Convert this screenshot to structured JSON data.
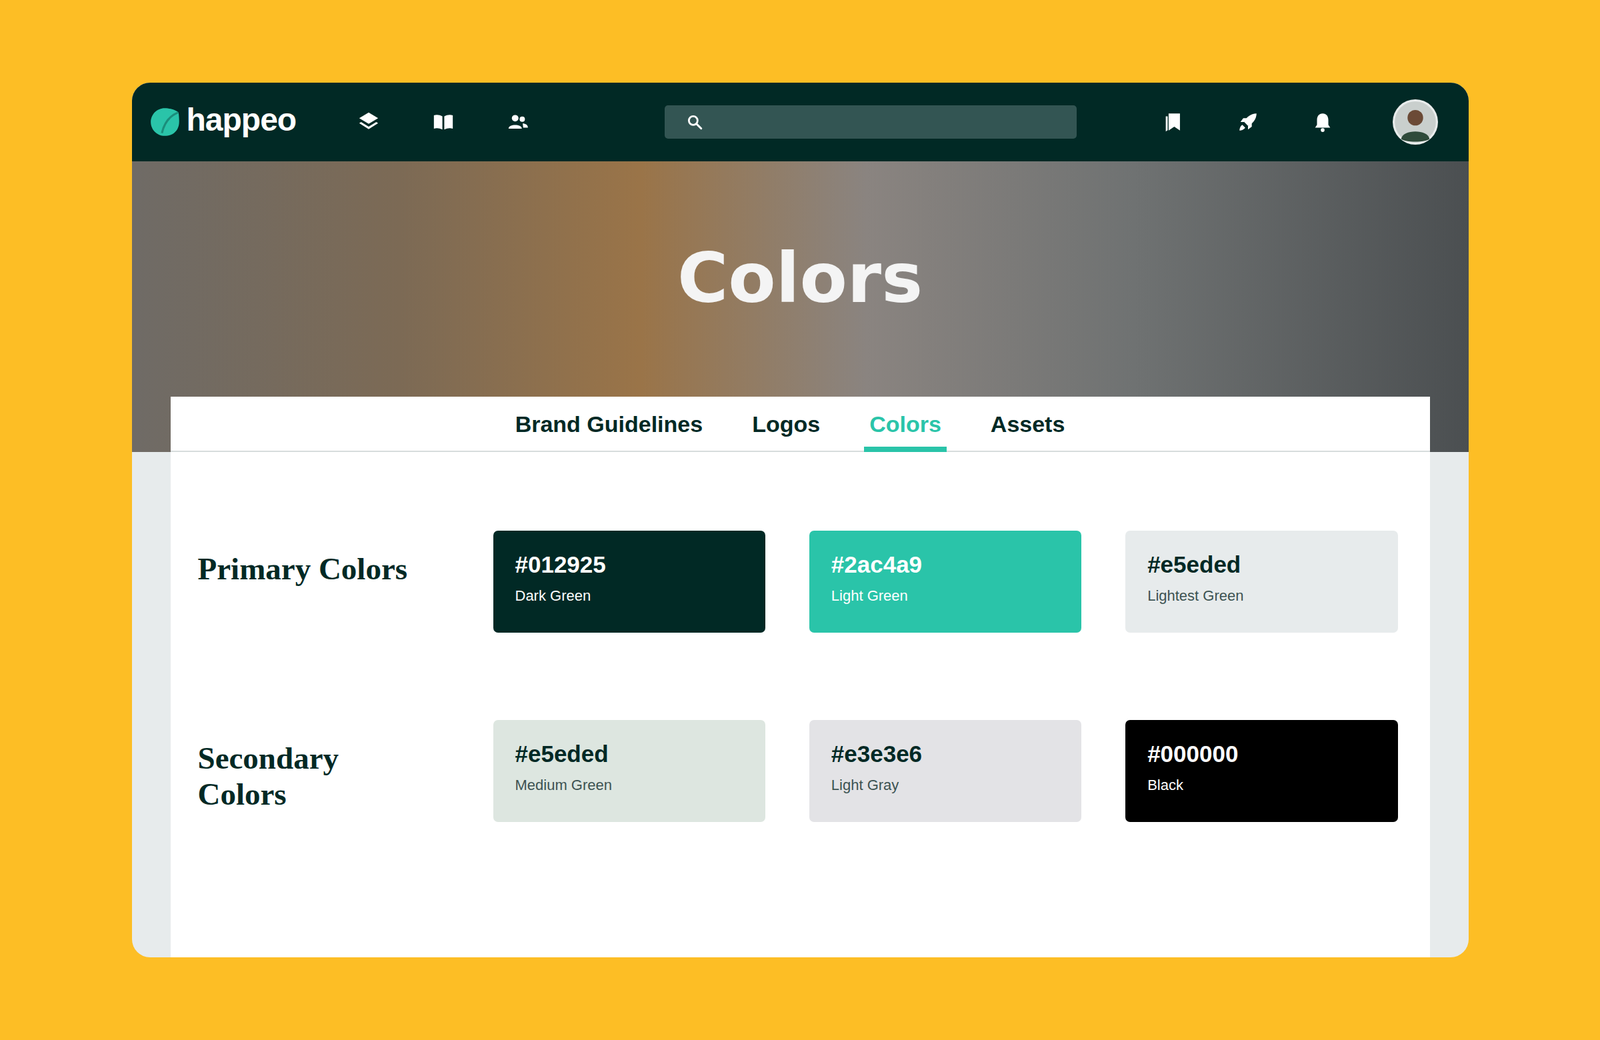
{
  "header": {
    "logo": "happeo"
  },
  "hero": {
    "title": "Colors"
  },
  "tabs": [
    {
      "label": "Brand Guidelines",
      "selected": false
    },
    {
      "label": "Logos",
      "selected": false
    },
    {
      "label": "Colors",
      "selected": true
    },
    {
      "label": "Assets",
      "selected": false
    }
  ],
  "sections": [
    {
      "title": "Primary Colors",
      "swatches": [
        {
          "hex": "#012925",
          "name": "Dark Green",
          "color": "#012925"
        },
        {
          "hex": "#2ac4a9",
          "name": "Light Green",
          "color": "#2ac4a9"
        },
        {
          "hex": "#e5eded",
          "name": "Lightest Green",
          "color": "#e7ebec"
        }
      ]
    },
    {
      "title": "Secondary Colors",
      "swatches": [
        {
          "hex": "#e5eded",
          "name": "Medium Green",
          "color": "#dde6e0"
        },
        {
          "hex": "#e3e3e6",
          "name": "Light Gray",
          "color": "#e3e3e6"
        },
        {
          "hex": "#000000",
          "name": "Black",
          "color": "#000000"
        }
      ]
    }
  ]
}
